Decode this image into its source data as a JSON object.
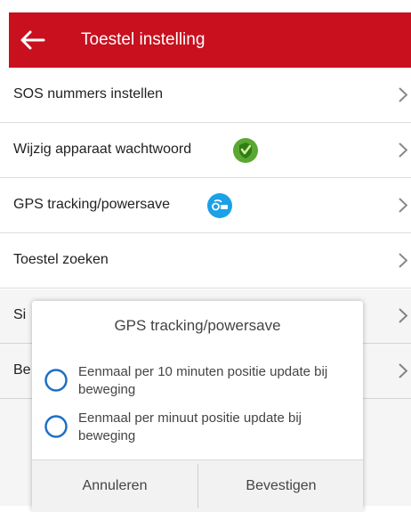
{
  "header": {
    "title": "Toestel instelling"
  },
  "list": {
    "items": [
      {
        "label": "SOS nummers instellen"
      },
      {
        "label": "Wijzig apparaat wachtwoord"
      },
      {
        "label": "GPS tracking/powersave"
      },
      {
        "label": "Toestel zoeken"
      },
      {
        "label": "Si"
      },
      {
        "label": "Be"
      }
    ]
  },
  "dialog": {
    "title": "GPS tracking/powersave",
    "options": [
      {
        "label": "Eenmaal per 10 minuten positie update bij beweging"
      },
      {
        "label": "Eenmaal per minuut positie update bij beweging"
      }
    ],
    "cancel": "Annuleren",
    "confirm": "Bevestigen"
  },
  "colors": {
    "header_bg": "#c8101e",
    "shield_icon": "#5aa832",
    "gps_icon": "#1aa1e6",
    "radio": "#1f6fc5"
  }
}
